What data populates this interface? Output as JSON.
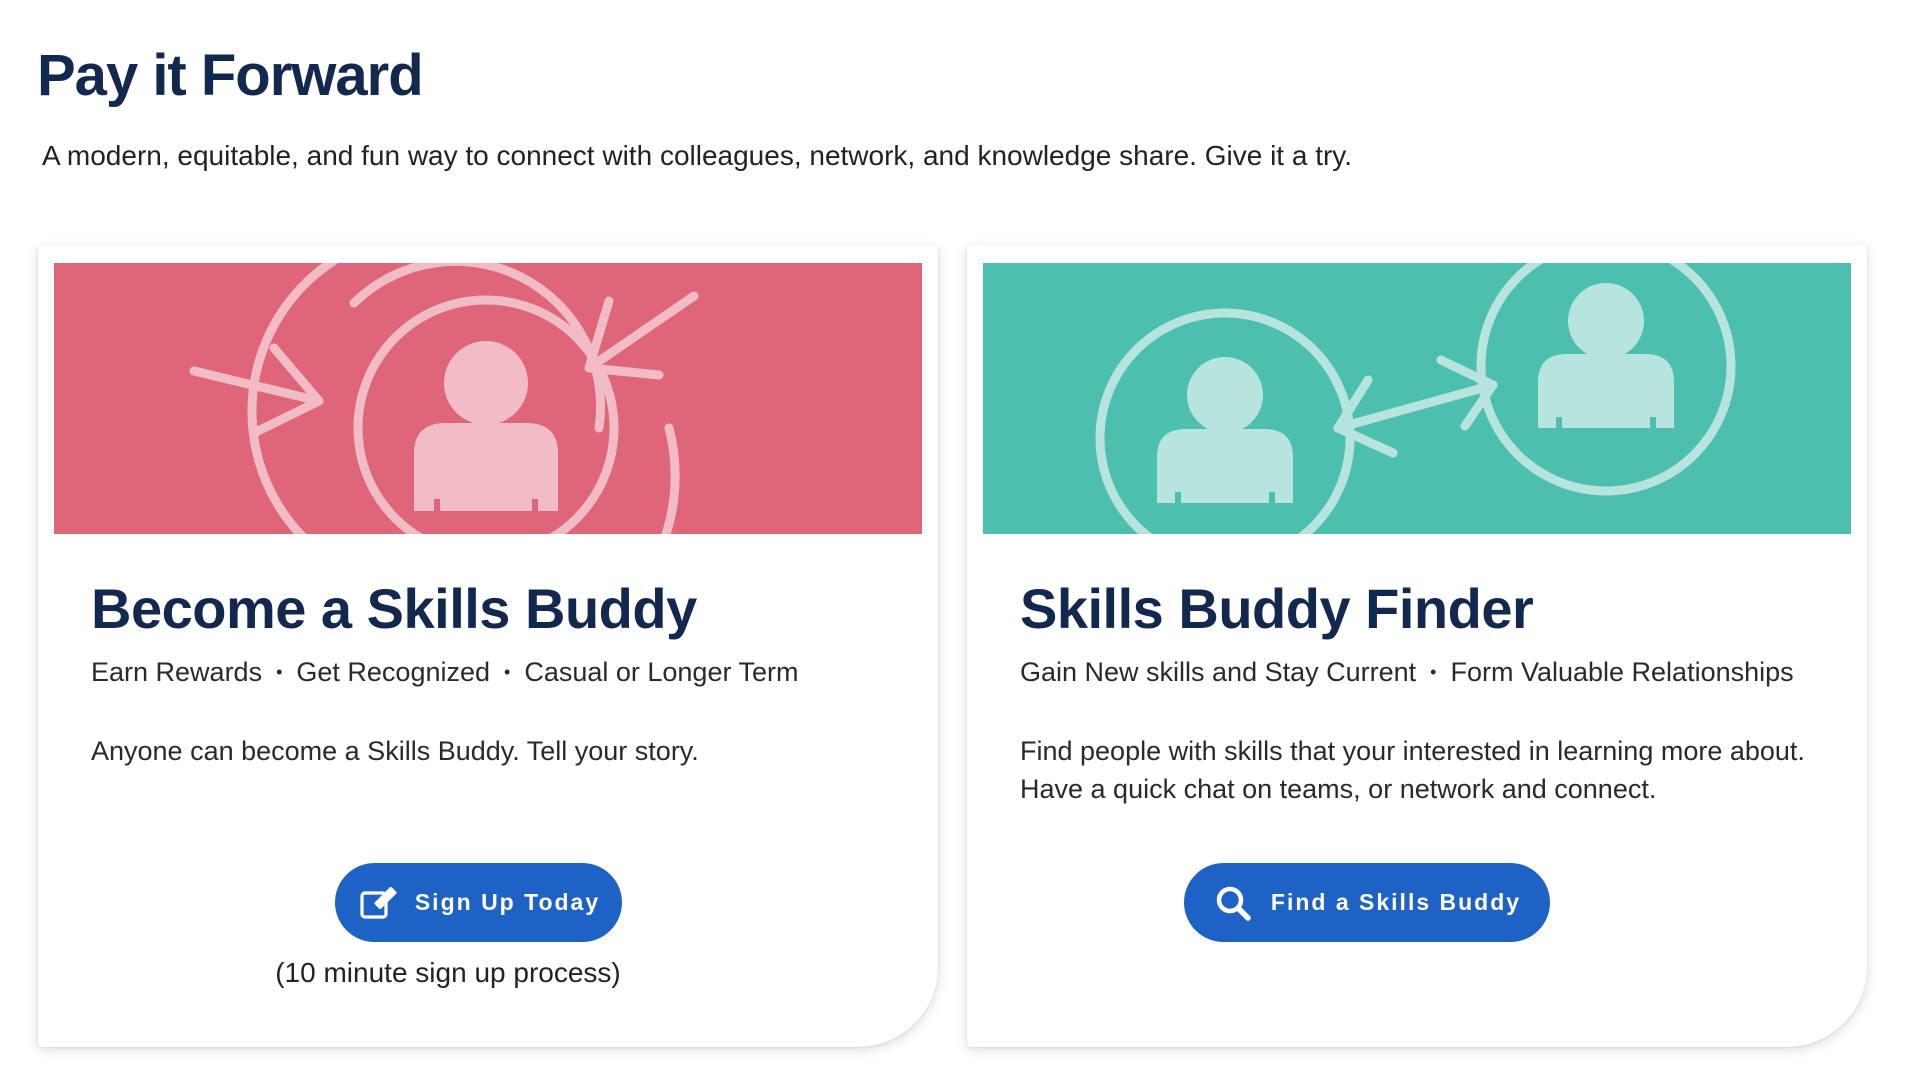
{
  "header": {
    "title": "Pay it Forward",
    "subtitle": "A modern, equitable, and fun way to connect with colleagues, network, and knowledge share. Give it a try."
  },
  "cards": [
    {
      "banner_color": "#df6579",
      "banner_icon": "person-with-incoming-arrows-illustration",
      "title": "Become a Skills Buddy",
      "tags": [
        "Earn Rewards",
        "Get Recognized",
        "Casual or Longer Term"
      ],
      "description": "Anyone can become a Skills Buddy. Tell your story.",
      "button": {
        "label": "Sign Up Today",
        "icon": "edit-icon"
      },
      "note": "(10 minute sign up process)"
    },
    {
      "banner_color": "#4cbfae",
      "banner_icon": "two-people-connected-arrows-illustration",
      "title": "Skills Buddy Finder",
      "tags": [
        "Gain New skills and Stay Current",
        "Form Valuable Relationships"
      ],
      "description_lines": [
        "Find people with skills that your interested in learning more about.",
        "Have a quick chat on teams, or network and connect."
      ],
      "button": {
        "label": "Find a Skills Buddy",
        "icon": "search-icon"
      }
    }
  ],
  "colors": {
    "title": "#13284f",
    "button": "#1f62c5",
    "pink_banner": "#df6579",
    "teal_banner": "#4cbfae"
  }
}
